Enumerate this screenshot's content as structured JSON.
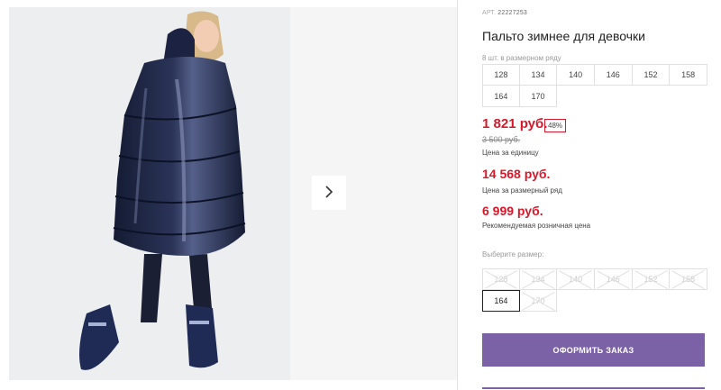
{
  "product": {
    "sku_label": "АРТ.",
    "sku": "22227253",
    "title": "Пальто зимнее для девочки",
    "image_icon": "product-photo-girl-in-navy-puffer-coat"
  },
  "pack": {
    "note": "8 шт. в размерном ряду",
    "sizes": [
      "128",
      "134",
      "140",
      "146",
      "152",
      "158",
      "164",
      "170"
    ]
  },
  "prices": {
    "unit_price": "1 821 руб.",
    "discount": "48%",
    "old_price": "3 500 руб.",
    "unit_caption": "Цена за единицу",
    "pack_price": "14 568 руб.",
    "pack_caption": "Цена за размерный ряд",
    "rrp": "6 999 руб.",
    "rrp_caption": "Рекомендуемая розничная цена"
  },
  "size_picker": {
    "label": "Выберите размер:",
    "options": [
      "128",
      "134",
      "140",
      "146",
      "152",
      "158",
      "164",
      "170"
    ],
    "selected": "164"
  },
  "actions": {
    "order_label": "ОФОРМИТЬ ЗАКАЗ",
    "next_icon": "chevron-right-icon"
  },
  "colors": {
    "price_red": "#d7182a",
    "button_purple": "#7b62a6"
  }
}
